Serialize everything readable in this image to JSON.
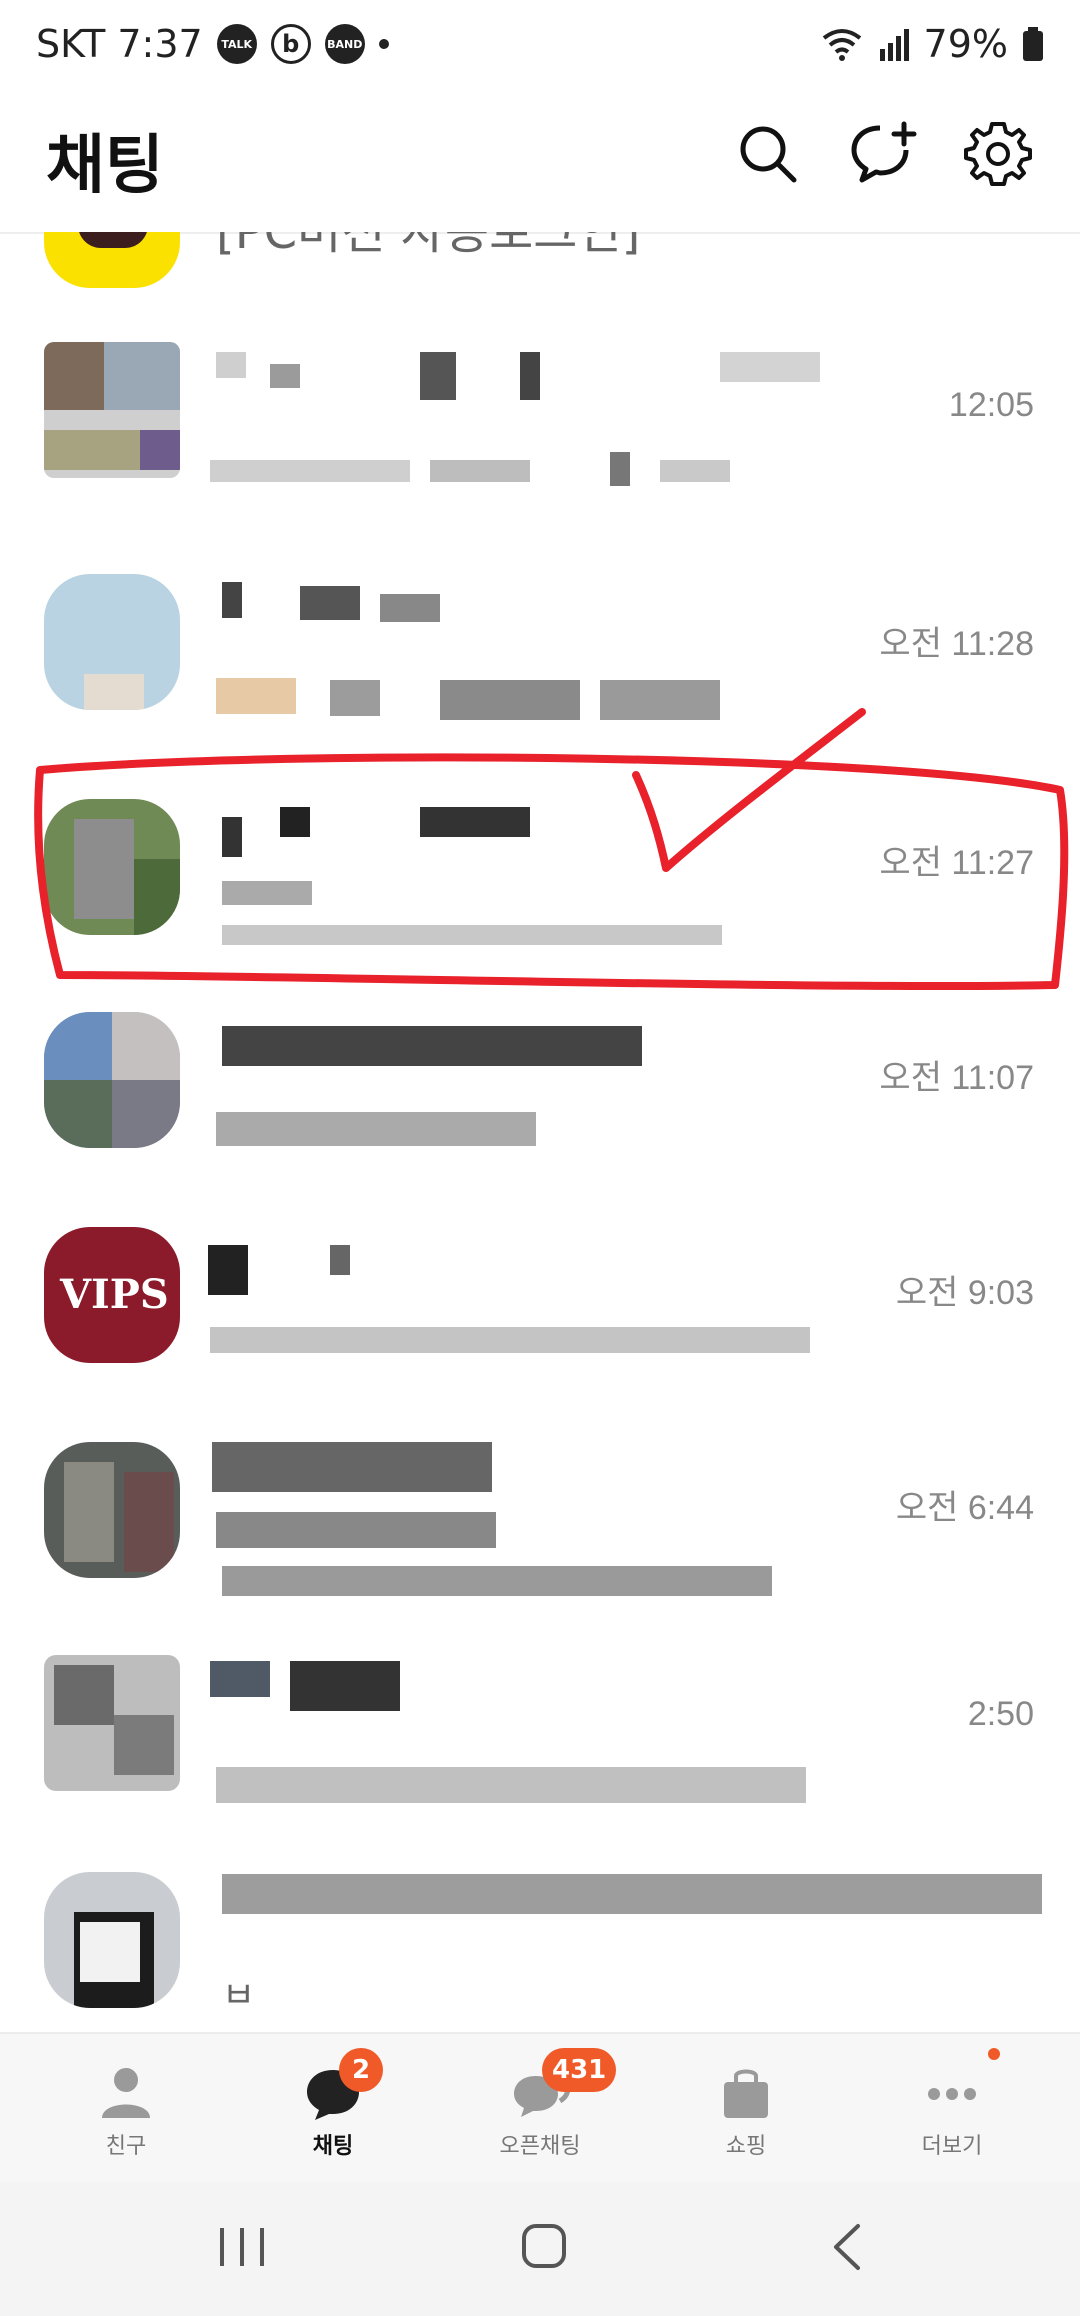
{
  "status_bar": {
    "carrier_time": "SKT 7:37",
    "talk_badge": "TALK",
    "b_badge": "b",
    "band_badge": "BAND",
    "battery": "79%"
  },
  "header": {
    "title": "채팅"
  },
  "chats": [
    {
      "name": "[PC버전 자동로그인]",
      "time": ""
    },
    {
      "name": "",
      "time": "12:05"
    },
    {
      "name": "",
      "time": "오전 11:28"
    },
    {
      "name": "",
      "time": "오전 11:27"
    },
    {
      "name": "",
      "time": "오전 11:07"
    },
    {
      "name": "",
      "time": "오전 9:03",
      "avatar_text": "VIPS"
    },
    {
      "name": "",
      "time": "오전 6:44"
    },
    {
      "name": "",
      "time": "2:50"
    },
    {
      "name": "",
      "time": "",
      "preview_char": "ㅂ"
    }
  ],
  "tabbar": {
    "tabs": [
      {
        "label": "친구",
        "icon": "person-icon",
        "badge": ""
      },
      {
        "label": "채팅",
        "icon": "chat-bubble-icon",
        "badge": "2"
      },
      {
        "label": "오픈채팅",
        "icon": "open-chat-icon",
        "badge": "431"
      },
      {
        "label": "쇼핑",
        "icon": "shopping-bag-icon",
        "badge": ""
      },
      {
        "label": "더보기",
        "icon": "more-dots-icon",
        "badge": ""
      }
    ]
  },
  "colors": {
    "accent": "#f05a28",
    "annotation": "#e8212b",
    "kakao_yellow": "#fae100"
  }
}
